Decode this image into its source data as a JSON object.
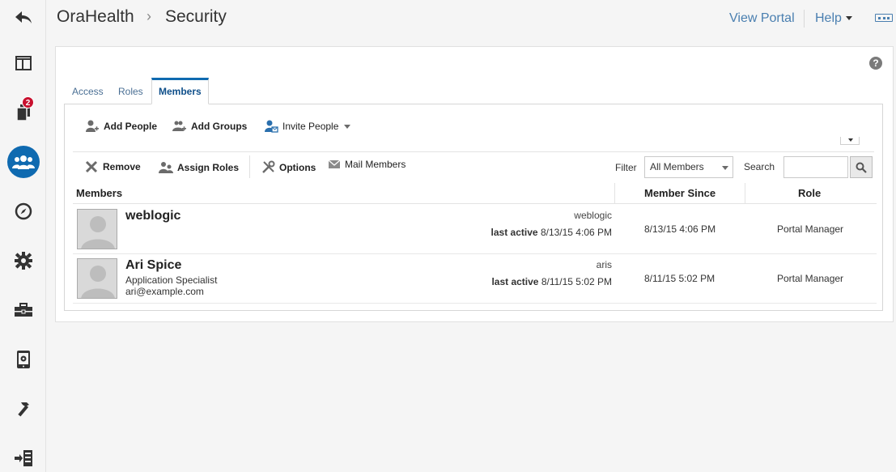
{
  "header": {
    "site": "OraHealth",
    "separator": "›",
    "page": "Security",
    "view_portal": "View Portal",
    "help": "Help"
  },
  "rail": {
    "items": [
      {
        "icon": "back-arrow-icon"
      },
      {
        "icon": "layout-icon"
      },
      {
        "icon": "pages-icon",
        "badge": "2"
      },
      {
        "icon": "members-icon",
        "active": true
      },
      {
        "icon": "compass-icon"
      },
      {
        "icon": "gear-icon"
      },
      {
        "icon": "toolbox-icon"
      },
      {
        "icon": "device-settings-icon"
      },
      {
        "icon": "hammer-icon"
      },
      {
        "icon": "import-icon"
      }
    ]
  },
  "tabs": [
    "Access",
    "Roles",
    "Members"
  ],
  "active_tab": "Members",
  "toolbar1": {
    "add_people": "Add People",
    "add_groups": "Add Groups",
    "invite_people": "Invite People"
  },
  "toolbar2": {
    "remove": "Remove",
    "assign_roles": "Assign Roles",
    "options": "Options",
    "mail_members": "Mail Members",
    "filter_label": "Filter",
    "filter_value": "All Members",
    "search_label": "Search",
    "search_value": ""
  },
  "table": {
    "headers": [
      "Members",
      "Member Since",
      "Role"
    ],
    "rows": [
      {
        "name": "weblogic",
        "title": "",
        "email": "",
        "username": "weblogic",
        "last_active_label": "last active",
        "last_active": "8/13/15 4:06 PM",
        "member_since": "8/13/15 4:06 PM",
        "role": "Portal Manager"
      },
      {
        "name": "Ari Spice",
        "title": "Application Specialist",
        "email": "ari@example.com",
        "username": "aris",
        "last_active_label": "last active",
        "last_active": "8/11/15 5:02 PM",
        "member_since": "8/11/15 5:02 PM",
        "role": "Portal Manager"
      }
    ]
  },
  "colors": {
    "accent": "#0f6ab0",
    "link": "#4a7fb0",
    "badge": "#c8102e"
  }
}
